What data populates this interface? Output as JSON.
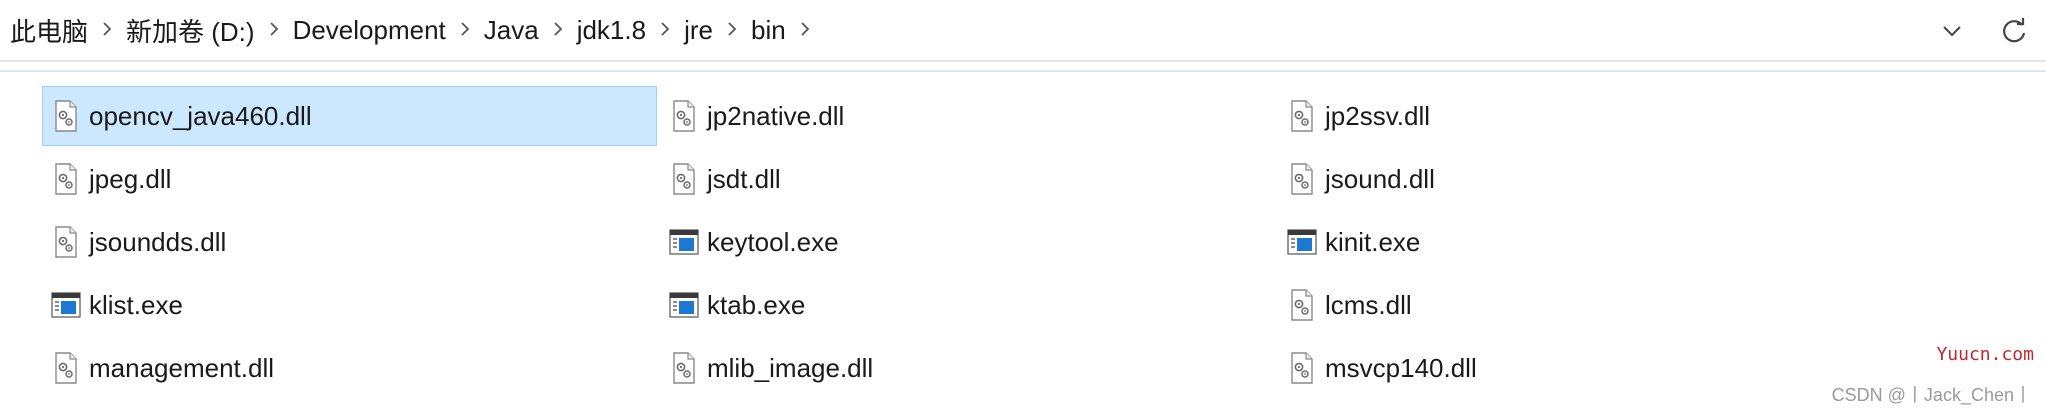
{
  "breadcrumb": {
    "items": [
      {
        "label": "此电脑"
      },
      {
        "label": "新加卷 (D:)"
      },
      {
        "label": "Development"
      },
      {
        "label": "Java"
      },
      {
        "label": "jdk1.8"
      },
      {
        "label": "jre"
      },
      {
        "label": "bin"
      }
    ],
    "separator": ">"
  },
  "toolbar": {
    "dropdown_icon": "chevron-down-icon",
    "refresh_icon": "refresh-icon"
  },
  "files": [
    {
      "name": "opencv_java460.dll",
      "type": "dll",
      "selected": true
    },
    {
      "name": "jp2native.dll",
      "type": "dll",
      "selected": false
    },
    {
      "name": "jp2ssv.dll",
      "type": "dll",
      "selected": false
    },
    {
      "name": "jpeg.dll",
      "type": "dll",
      "selected": false
    },
    {
      "name": "jsdt.dll",
      "type": "dll",
      "selected": false
    },
    {
      "name": "jsound.dll",
      "type": "dll",
      "selected": false
    },
    {
      "name": "jsoundds.dll",
      "type": "dll",
      "selected": false
    },
    {
      "name": "keytool.exe",
      "type": "exe",
      "selected": false
    },
    {
      "name": "kinit.exe",
      "type": "exe",
      "selected": false
    },
    {
      "name": "klist.exe",
      "type": "exe",
      "selected": false
    },
    {
      "name": "ktab.exe",
      "type": "exe",
      "selected": false
    },
    {
      "name": "lcms.dll",
      "type": "dll",
      "selected": false
    },
    {
      "name": "management.dll",
      "type": "dll",
      "selected": false
    },
    {
      "name": "mlib_image.dll",
      "type": "dll",
      "selected": false
    },
    {
      "name": "msvcp140.dll",
      "type": "dll",
      "selected": false
    }
  ],
  "watermarks": {
    "site": "Yuucn.com",
    "author": "CSDN @丨Jack_Chen丨"
  },
  "colors": {
    "selection_bg": "#cce8ff",
    "selection_border": "#99d1ff",
    "exe_icon_blue": "#1e78d2"
  }
}
